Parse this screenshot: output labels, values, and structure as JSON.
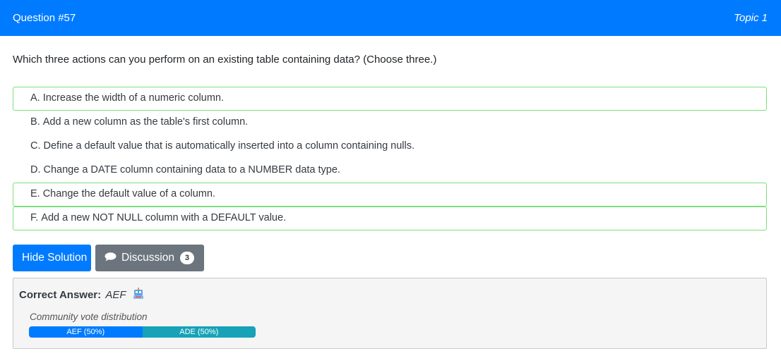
{
  "header": {
    "question_number": "Question #57",
    "topic": "Topic 1"
  },
  "question": {
    "text": "Which three actions can you perform on an existing table containing data? (Choose three.)"
  },
  "choices": [
    {
      "letter": "A.",
      "text": "Increase the width of a numeric column.",
      "correct": true
    },
    {
      "letter": "B.",
      "text": "Add a new column as the table's first column.",
      "correct": false
    },
    {
      "letter": "C.",
      "text": "Define a default value that is automatically inserted into a column containing nulls.",
      "correct": false
    },
    {
      "letter": "D.",
      "text": "Change a DATE column containing data to a NUMBER data type.",
      "correct": false
    },
    {
      "letter": "E.",
      "text": "Change the default value of a column.",
      "correct": true
    },
    {
      "letter": "F.",
      "text": "Add a new NOT NULL column with a DEFAULT value.",
      "correct": true
    }
  ],
  "buttons": {
    "hide_solution": "Hide Solution",
    "discussion": "Discussion",
    "discussion_count": "3"
  },
  "answer": {
    "label": "Correct Answer:",
    "value": "AEF",
    "icon": "robot-icon"
  },
  "vote": {
    "label": "Community vote distribution",
    "segments": [
      {
        "label": "AEF (50%)",
        "percent": 50,
        "color": "#007bff"
      },
      {
        "label": "ADE (50%)",
        "percent": 50,
        "color": "#17a2b8"
      }
    ]
  },
  "colors": {
    "primary": "#007bff",
    "secondary": "#6c757d",
    "correct_border": "#7be07b",
    "info": "#17a2b8"
  }
}
